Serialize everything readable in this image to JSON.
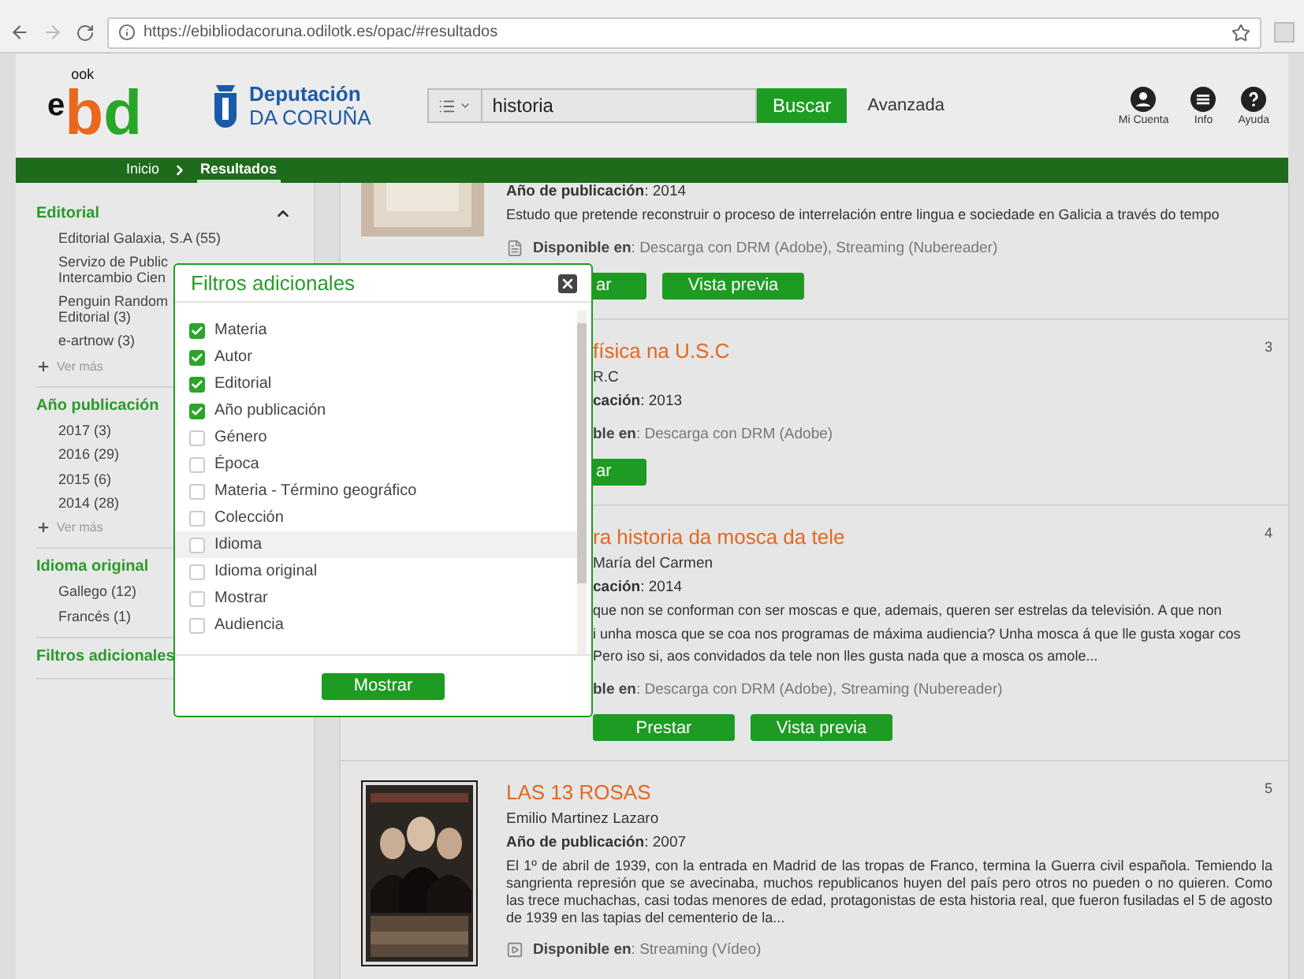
{
  "browser": {
    "url": "https://ebibliodacoruna.odilotk.es/opac/#resultados"
  },
  "header": {
    "logo": {
      "e": "e",
      "b": "b",
      "d": "d",
      "ook": "ook"
    },
    "org": {
      "line1": "Deputación",
      "line2": "DA CORUÑA"
    },
    "search": {
      "value": "historia",
      "button": "Buscar"
    },
    "advanced": "Avanzada",
    "icons": [
      {
        "kind": "account",
        "label": "Mi Cuenta"
      },
      {
        "kind": "info",
        "label": "Info"
      },
      {
        "kind": "help",
        "label": "Ayuda"
      }
    ]
  },
  "breadcrumb": [
    {
      "label": "Inicio",
      "selected": false
    },
    {
      "label": "Resultados",
      "selected": true
    }
  ],
  "sidebar": {
    "sections": [
      {
        "kind": "collapsible",
        "title": "Editorial",
        "items": [
          "Editorial Galaxia, S.A (55)",
          "Servizo de Public\nIntercambio Cien",
          "Penguin Random\nEditorial (3)",
          "e-artnow (3)"
        ],
        "more": "Ver más"
      },
      {
        "kind": "plain",
        "title": "Año publicación",
        "items": [
          "2017 (3)",
          "2016 (29)",
          "2015 (6)",
          "2014 (28)"
        ],
        "more": "Ver más"
      },
      {
        "kind": "plain",
        "title": "Idioma original",
        "items": [
          "Gallego (12)",
          "Francés (1)"
        ]
      },
      {
        "kind": "plain",
        "title": "Filtros adicionales"
      }
    ]
  },
  "results": [
    {
      "kind": "top-cut",
      "year": "**Año de publicación**: 2014",
      "description": [
        "Estudo que pretende reconstruir o proceso de interrelación entre lingua e sociedade en Galicia a través do tempo"
      ],
      "availability": "**Disponible en**: Descarga con DRM (Adobe), Streaming (Nubereader)",
      "buttons": [
        {
          "label": "ar",
          "kind": "cut"
        },
        {
          "label": "Vista previa",
          "kind": "full"
        }
      ]
    },
    {
      "kind": "covered",
      "number": "3",
      "title": "física na U.S.C",
      "author": "R.C",
      "year": "**cación**: 2013",
      "availability": "**ble en**: Descarga con DRM (Adobe)",
      "buttons": [
        {
          "label": "ar",
          "kind": "cut"
        }
      ]
    },
    {
      "kind": "covered",
      "number": "4",
      "title": "ra historia da mosca da tele",
      "author": "María del Carmen",
      "year": "**cación**: 2014",
      "description": [
        "que non se conforman con ser moscas e que, ademais, queren ser estrelas da televisión. A que non",
        "i unha mosca que se coa nos programas de máxima audiencia? Unha mosca á que lle gusta xogar cos",
        "Pero iso si, aos convidados da tele non lles gusta nada que a mosca os amole..."
      ],
      "availability": "**ble en**: Descarga con DRM (Adobe), Streaming (Nubereader)",
      "buttons": [
        {
          "label": "Prestar",
          "kind": "full"
        },
        {
          "label": "Vista previa",
          "kind": "full"
        }
      ]
    },
    {
      "kind": "poster",
      "number": "5",
      "title": "LAS 13 ROSAS",
      "author": "Emilio Martinez Lazaro",
      "year": "**Año de publicación**: 2007",
      "description": [
        "El 1º de abril de 1939, con la entrada en Madrid de las tropas de Franco, termina la Guerra civil española. Temiendo la sangrienta represión que se avecinaba, muchos republicanos huyen del país pero otros no pueden o no quieren. Como las trece muchachas, casi todas menores de edad, protagonistas de esta historia real, que fueron fusiladas el 5 de agosto de 1939 en las tapias del cementerio de la..."
      ],
      "availability": "**Disponible en**: Streaming (Vídeo)"
    }
  ],
  "modal": {
    "title": "Filtros adicionales",
    "options": [
      {
        "label": "Materia",
        "checked": true,
        "selected": false
      },
      {
        "label": "Autor",
        "checked": true,
        "selected": false
      },
      {
        "label": "Editorial",
        "checked": true,
        "selected": false
      },
      {
        "label": "Año publicación",
        "checked": true,
        "selected": false
      },
      {
        "label": "Género",
        "checked": false,
        "selected": false
      },
      {
        "label": "Época",
        "checked": false,
        "selected": false
      },
      {
        "label": "Materia - Término geográfico",
        "checked": false,
        "selected": false
      },
      {
        "label": "Colección",
        "checked": false,
        "selected": false
      },
      {
        "label": "Idioma",
        "checked": false,
        "selected": true
      },
      {
        "label": "Idioma original",
        "checked": false,
        "selected": false
      },
      {
        "label": "Mostrar",
        "checked": false,
        "selected": false
      },
      {
        "label": "Audiencia",
        "checked": false,
        "selected": false
      }
    ],
    "button": "Mostrar"
  }
}
